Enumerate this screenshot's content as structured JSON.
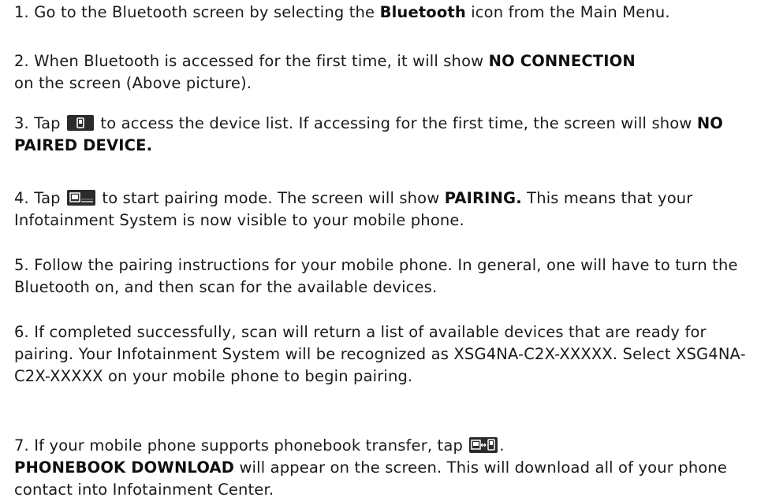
{
  "steps": [
    {
      "prefix": "1. Go to the Bluetooth screen by selecting the ",
      "bold": "Bluetooth",
      "suffix": " icon from the Main Menu."
    },
    {
      "prefix": "2. When Bluetooth is accessed for the first time, it will show ",
      "bold": "NO CONNECTION",
      "suffix": " on the screen (Above picture)."
    },
    {
      "prefix": "3. Tap ",
      "icon": "phone-device-icon",
      "middle": " to access the device list. If accessing for the first time, the screen will show ",
      "bold": "NO PAIRED DEVICE.",
      "suffix": ""
    },
    {
      "prefix": "4. Tap ",
      "icon": "new-pairing-icon",
      "middle": " to start pairing mode. The screen will show ",
      "bold": "PAIRING.",
      "suffix": " This means that your Infotainment System is now visible to your mobile phone."
    },
    {
      "text": "5. Follow the pairing instructions for your mobile phone. In general, one will have to turn the Bluetooth on, and then scan for the available devices."
    },
    {
      "text": "6. If completed successfully, scan will return a list of available devices that are ready for pairing. Your Infotainment System will be recognized as XSG4NA-C2X-XXXXX. Select XSG4NA-C2X-XXXXX on your mobile phone to begin pairing."
    },
    {
      "prefix": "7. If your mobile phone supports phonebook transfer, tap ",
      "icon": "phonebook-transfer-icon",
      "middle": ".",
      "bold": "PHONEBOOK DOWNLOAD",
      "suffix": " will appear on the screen. This will download all of your phone contact into Infotainment Center."
    }
  ],
  "icon_colors": {
    "button_fill": "#2b2b2b",
    "glyph": "#ffffff"
  }
}
